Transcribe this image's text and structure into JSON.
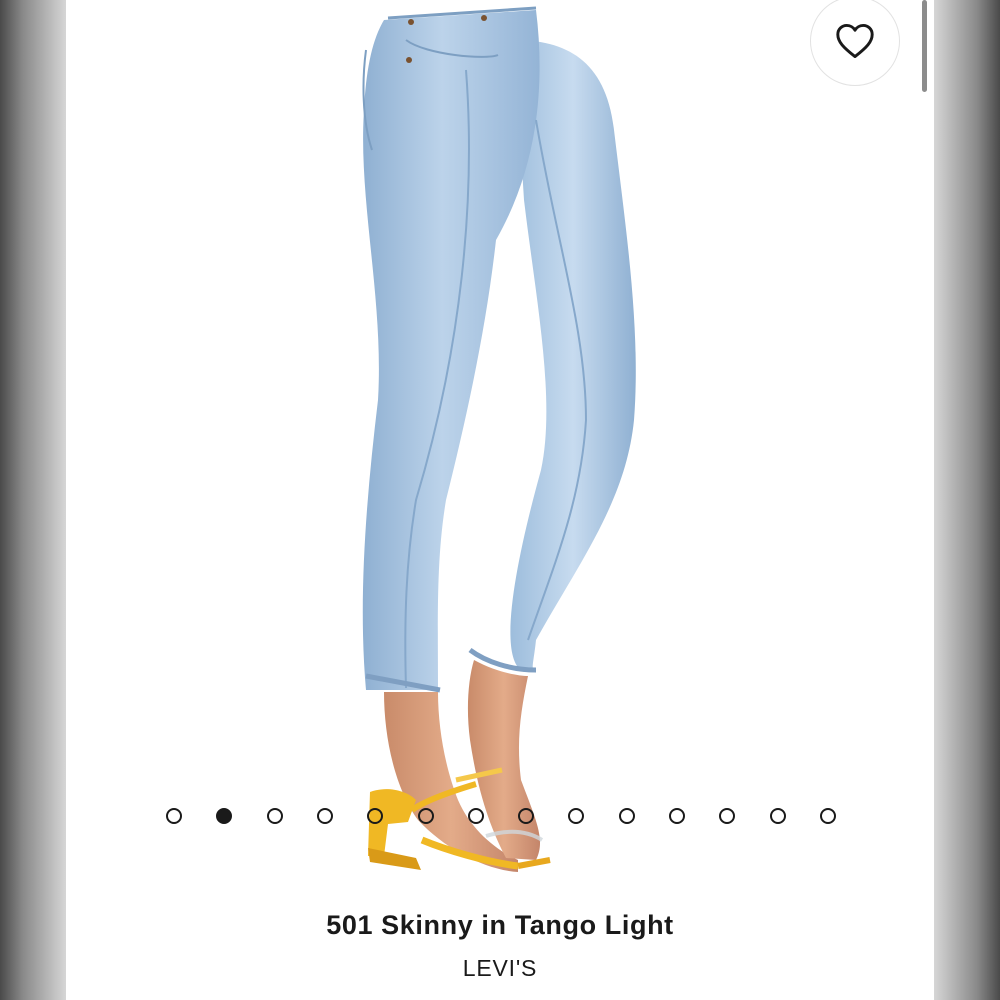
{
  "product": {
    "title": "501 Skinny in Tango Light",
    "brand": "LEVI'S"
  },
  "favorite": {
    "icon": "heart-outline-icon"
  },
  "gallery": {
    "image_count": 14,
    "active_index": 1
  },
  "colors": {
    "denim": "#a9c4de",
    "sandal": "#f0b824",
    "dot": "#1a1a1a"
  }
}
